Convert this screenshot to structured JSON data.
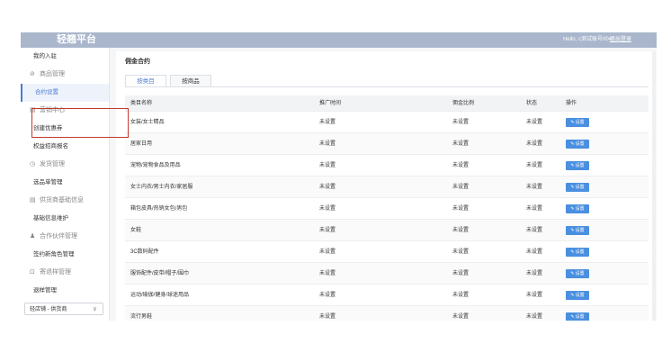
{
  "header": {
    "logo": "轻翘平台",
    "greeting": "Hello, c测试账号004",
    "logout": "退出登录"
  },
  "sidebar": {
    "items": [
      {
        "label": "我的入驻",
        "kind": "sub"
      },
      {
        "label": "商品管理",
        "kind": "group",
        "icon": "tag-icon"
      },
      {
        "label": "合约设置",
        "kind": "sub",
        "active": true
      },
      {
        "label": "营销中心",
        "kind": "group",
        "icon": "calendar-icon"
      },
      {
        "label": "创建优惠券",
        "kind": "sub"
      },
      {
        "label": "权益招商报名",
        "kind": "sub"
      },
      {
        "label": "发货管理",
        "kind": "group",
        "icon": "clock-icon"
      },
      {
        "label": "选品单管理",
        "kind": "sub"
      },
      {
        "label": "供货商基础信息",
        "kind": "group",
        "icon": "store-icon"
      },
      {
        "label": "基础信息维护",
        "kind": "sub"
      },
      {
        "label": "合作伙伴管理",
        "kind": "group",
        "icon": "person-icon"
      },
      {
        "label": "签约新角色管理",
        "kind": "sub"
      },
      {
        "label": "寄退样管理",
        "kind": "group",
        "icon": "cart-icon"
      },
      {
        "label": "退样管理",
        "kind": "sub"
      }
    ],
    "store_select": "轻店铺 - 供货商"
  },
  "main": {
    "title": "佣金合约",
    "tabs": [
      {
        "label": "按类目",
        "active": true
      },
      {
        "label": "按商品",
        "active": false
      }
    ],
    "table": {
      "columns": [
        "类目名称",
        "推广时间",
        "佣金比例",
        "状态",
        "操作"
      ],
      "action_label": "设置",
      "rows": [
        [
          "女装/女士精品",
          "未设置",
          "未设置",
          "未设置"
        ],
        [
          "居家日用",
          "未设置",
          "未设置",
          "未设置"
        ],
        [
          "宠物/宠物食品及用品",
          "未设置",
          "未设置",
          "未设置"
        ],
        [
          "女士内衣/男士内衣/家居服",
          "未设置",
          "未设置",
          "未设置"
        ],
        [
          "箱包皮具/热销女包/男包",
          "未设置",
          "未设置",
          "未设置"
        ],
        [
          "女鞋",
          "未设置",
          "未设置",
          "未设置"
        ],
        [
          "3C数码配件",
          "未设置",
          "未设置",
          "未设置"
        ],
        [
          "服饰配件/皮带/帽子/围巾",
          "未设置",
          "未设置",
          "未设置"
        ],
        [
          "运动/瑜伽/健身/球迷用品",
          "未设置",
          "未设置",
          "未设置"
        ],
        [
          "流行男鞋",
          "未设置",
          "未设置",
          "未设置"
        ]
      ]
    }
  },
  "colors": {
    "topbar": "#a9b6cc",
    "accent": "#4a7bd0",
    "button": "#4a8fe0",
    "highlight_box": "#c0392b"
  }
}
